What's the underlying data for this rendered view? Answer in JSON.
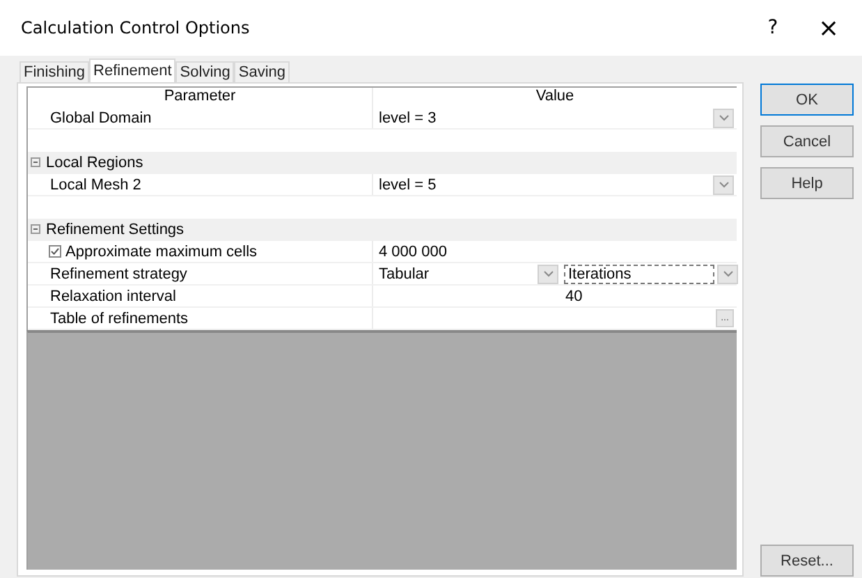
{
  "window": {
    "title": "Calculation Control Options",
    "help": "?",
    "close": "×"
  },
  "tabs": [
    {
      "label": "Finishing",
      "selected": false
    },
    {
      "label": "Refinement",
      "selected": true
    },
    {
      "label": "Solving",
      "selected": false
    },
    {
      "label": "Saving",
      "selected": false
    }
  ],
  "grid": {
    "columns": [
      "Parameter",
      "Value"
    ],
    "rows": [
      {
        "kind": "dropdown",
        "name": "Global Domain",
        "value": "level = 3"
      },
      {
        "kind": "blank"
      },
      {
        "kind": "group",
        "name": "Local Regions",
        "expanded": true
      },
      {
        "kind": "dropdown",
        "name": "Local Mesh 2",
        "value": "level = 5"
      },
      {
        "kind": "blank"
      },
      {
        "kind": "group",
        "name": "Refinement Settings",
        "expanded": true
      },
      {
        "kind": "checkbox",
        "name": "Approximate maximum cells",
        "checked": true,
        "value": "4 000 000"
      },
      {
        "kind": "dual",
        "name": "Refinement strategy",
        "value": "Tabular",
        "value2": "Iterations"
      },
      {
        "kind": "sub",
        "name": "Relaxation interval",
        "value2": "40"
      },
      {
        "kind": "ellipsis",
        "name": "Table of refinements",
        "button": "..."
      }
    ]
  },
  "buttons": [
    {
      "label": "OK",
      "default": true
    },
    {
      "label": "Cancel",
      "default": false
    },
    {
      "label": "Help",
      "default": false
    }
  ],
  "reset": "Reset..."
}
